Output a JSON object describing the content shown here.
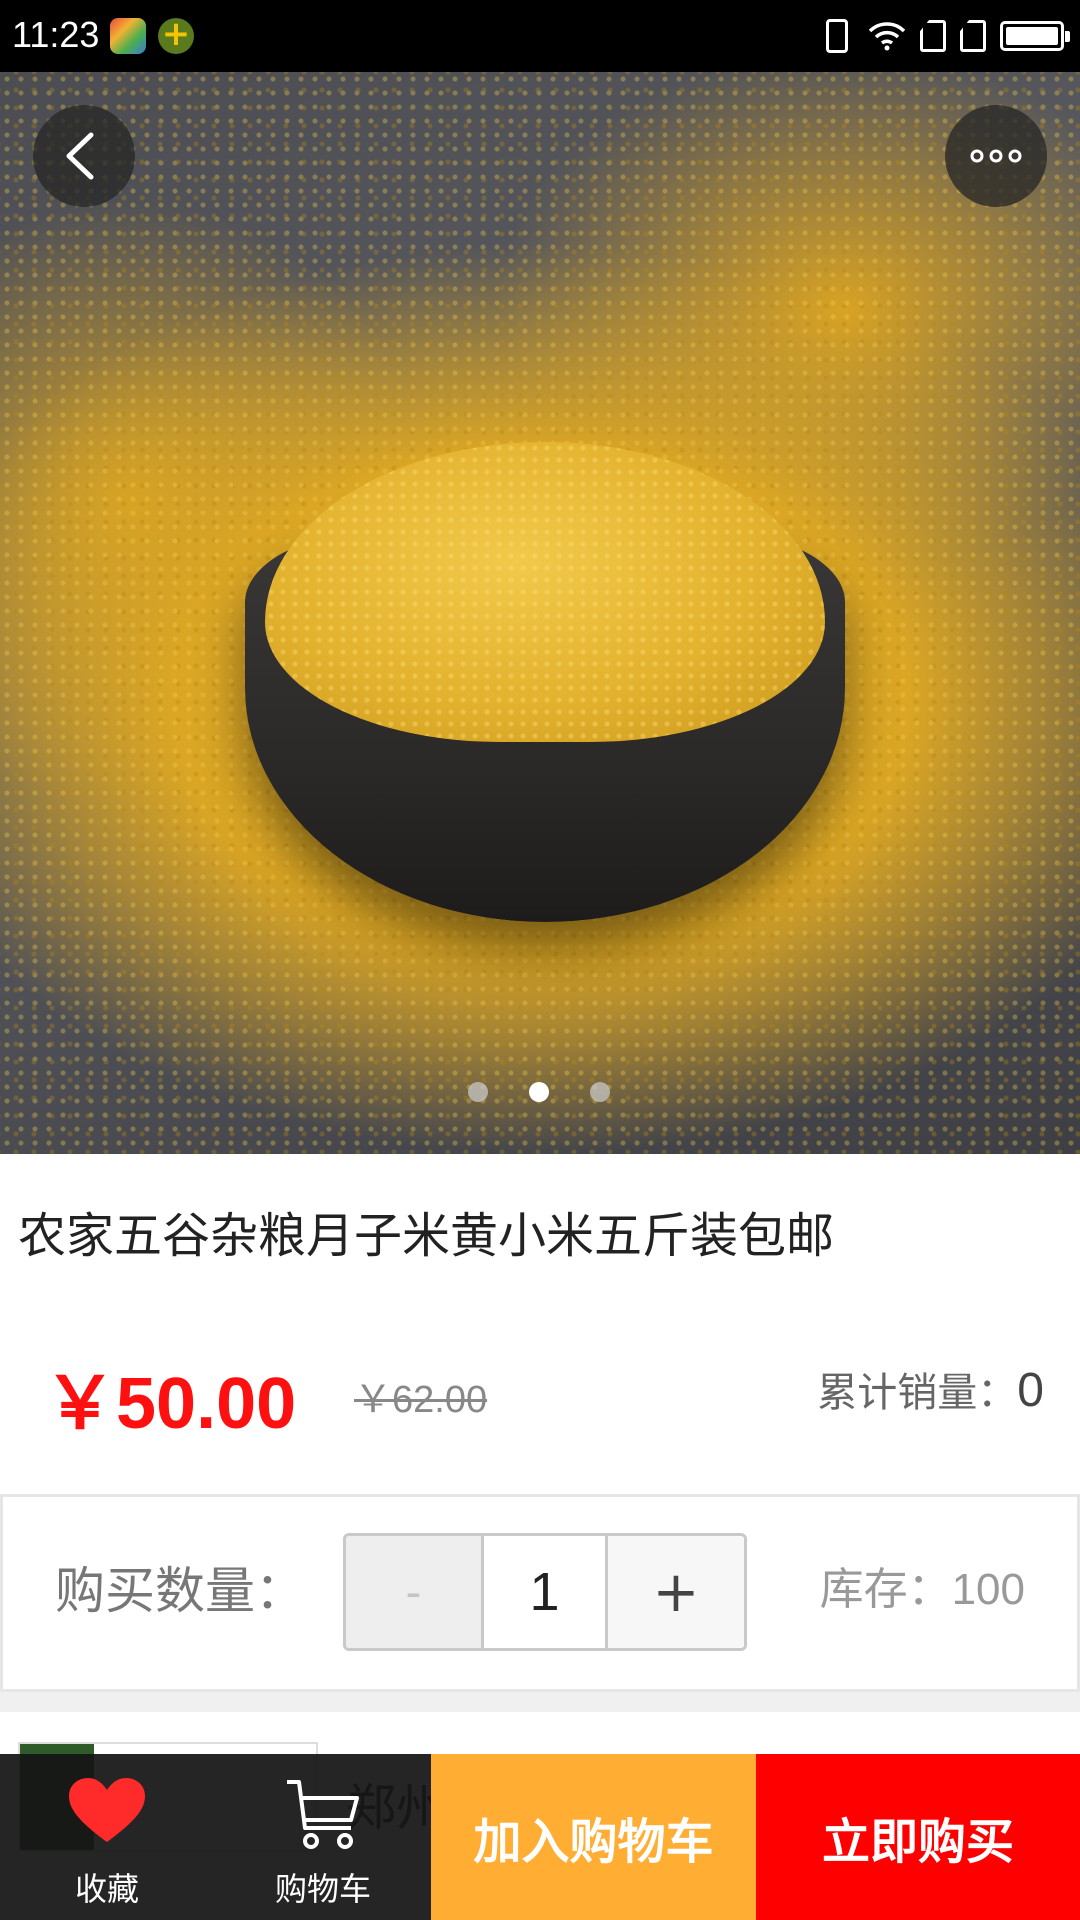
{
  "status_bar": {
    "time": "11:23",
    "icons": [
      "app-icon-colorful",
      "app-icon-green-plus",
      "vibrate-icon",
      "wifi-icon",
      "sim1-icon",
      "sim2-icon",
      "battery-icon"
    ]
  },
  "hero": {
    "back_icon": "chevron-left-icon",
    "more_icon": "more-dots-icon",
    "carousel": {
      "count": 3,
      "active_index": 1
    }
  },
  "product": {
    "title": "农家五谷杂粮月子米黄小米五斤装包邮",
    "price": "￥50.00",
    "original_price": "￥62.00",
    "sales_label": "累计销量：",
    "sales_value": "0"
  },
  "quantity": {
    "label": "购买数量：",
    "minus": "-",
    "value": "1",
    "plus": "+",
    "stock_label": "库存：",
    "stock_value": "100"
  },
  "store": {
    "name": "郑州"
  },
  "bottom_bar": {
    "favorite_label": "收藏",
    "cart_label": "购物车",
    "add_to_cart": "加入购物车",
    "buy_now": "立即购买"
  },
  "colors": {
    "price_red": "#ff1010",
    "add_cart_orange": "#ffad33",
    "buy_now_red": "#ff0000",
    "favorite_heart": "#ff2a2a"
  }
}
